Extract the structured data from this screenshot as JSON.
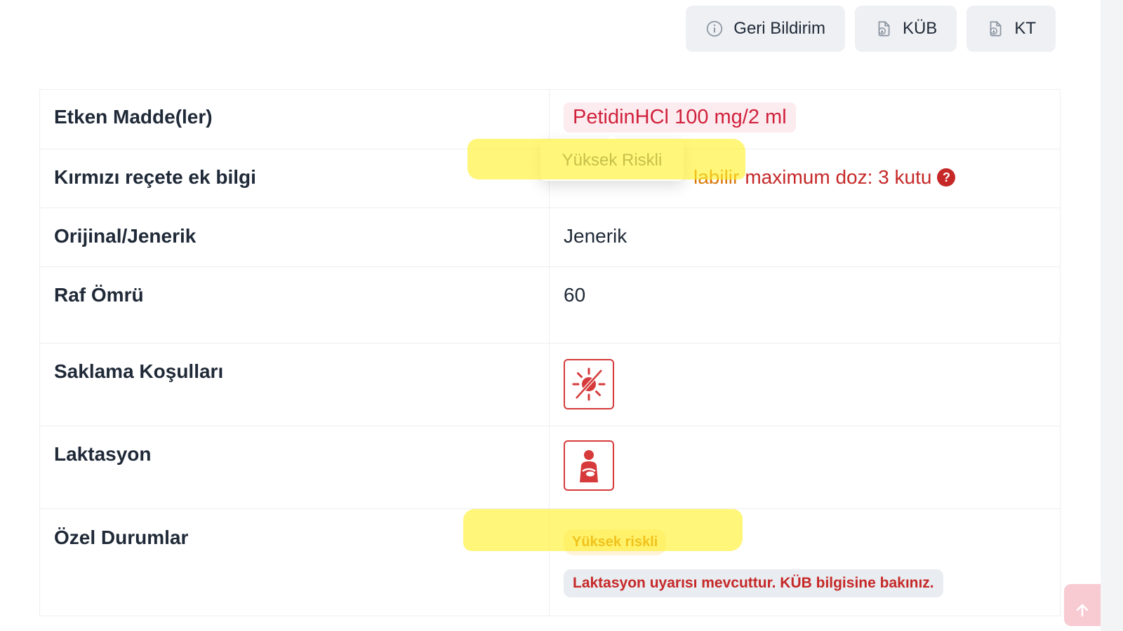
{
  "toolbar": {
    "feedback_label": "Geri Bildirim",
    "kub_label": "KÜB",
    "kt_label": "KT"
  },
  "rows": {
    "active_ingredient": {
      "label": "Etken Madde(ler)",
      "name": "PetidinHCl",
      "dose": "100 mg/2 ml"
    },
    "red_prescription": {
      "label": "Kırmızı reçete ek bilgi",
      "text_prefix": "labilir",
      "text_main": "maximum doz: 3 kutu"
    },
    "original_generic": {
      "label": "Orijinal/Jenerik",
      "value": "Jenerik"
    },
    "shelf_life": {
      "label": "Raf Ömrü",
      "value": "60"
    },
    "storage": {
      "label": "Saklama Koşulları",
      "icon": "no-sunlight-icon"
    },
    "lactation": {
      "label": "Laktasyon",
      "icon": "breastfeeding-icon"
    },
    "special": {
      "label": "Özel Durumlar",
      "badge": "Yüksek riskli",
      "warning": "Laktasyon uyarısı mevcuttur. KÜB bilgisine bakınız."
    }
  },
  "tooltip": {
    "text": "Yüksek Riskli"
  },
  "colors": {
    "accent_red": "#c62828",
    "pill_red_bg": "#fdecef",
    "highlight": "#fff028",
    "orange": "#d97706"
  }
}
